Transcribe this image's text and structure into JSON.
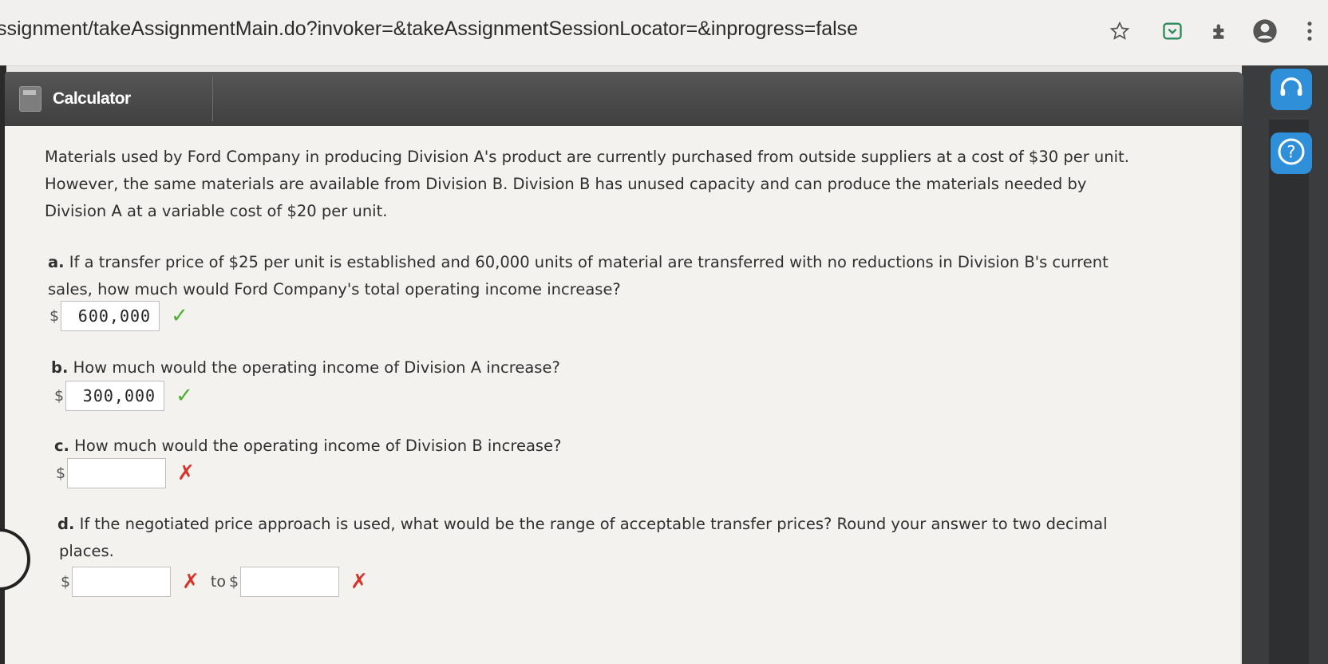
{
  "browser": {
    "url": "ssignment/takeAssignmentMain.do?invoker=&takeAssignmentSessionLocator=&inprogress=false",
    "icons": [
      "star-icon",
      "pocket-icon",
      "extension-icon",
      "account-icon",
      "menu-icon"
    ]
  },
  "toolbar": {
    "calculator_label": "Calculator"
  },
  "problem": {
    "intro_lines": [
      "Materials used by Ford Company in producing Division A's product are currently purchased from outside suppliers at a cost of $30 per unit.",
      "However, the same materials are available from Division B. Division B has unused capacity and can produce the materials needed by",
      "Division A at a variable cost of $20 per unit."
    ],
    "a": {
      "letter": "a.",
      "lines": [
        "If a transfer price of $25 per unit is established and 60,000 units of material are transferred with no reductions in Division B's current",
        "sales, how much would Ford Company's total operating income increase?"
      ],
      "currency": "$",
      "value": "600,000",
      "status": "correct"
    },
    "b": {
      "letter": "b.",
      "text": "How much would the operating income of Division A increase?",
      "currency": "$",
      "value": "300,000",
      "status": "correct"
    },
    "c": {
      "letter": "c.",
      "text": "How much would the operating income of Division B increase?",
      "currency": "$",
      "value": "",
      "status": "incorrect"
    },
    "d": {
      "letter": "d.",
      "lines": [
        "If the negotiated price approach is used, what would be the range of acceptable transfer prices? Round your answer to two decimal",
        "places."
      ],
      "currency": "$",
      "from_value": "",
      "to_label": "to",
      "to_currency": "$",
      "to_value": "",
      "status": "incorrect"
    }
  },
  "marks": {
    "check": "✓",
    "cross": "✗",
    "help": "?"
  },
  "colors": {
    "correct": "#4caf2f",
    "incorrect": "#d9322b",
    "rail_button": "#2f8fd8"
  }
}
